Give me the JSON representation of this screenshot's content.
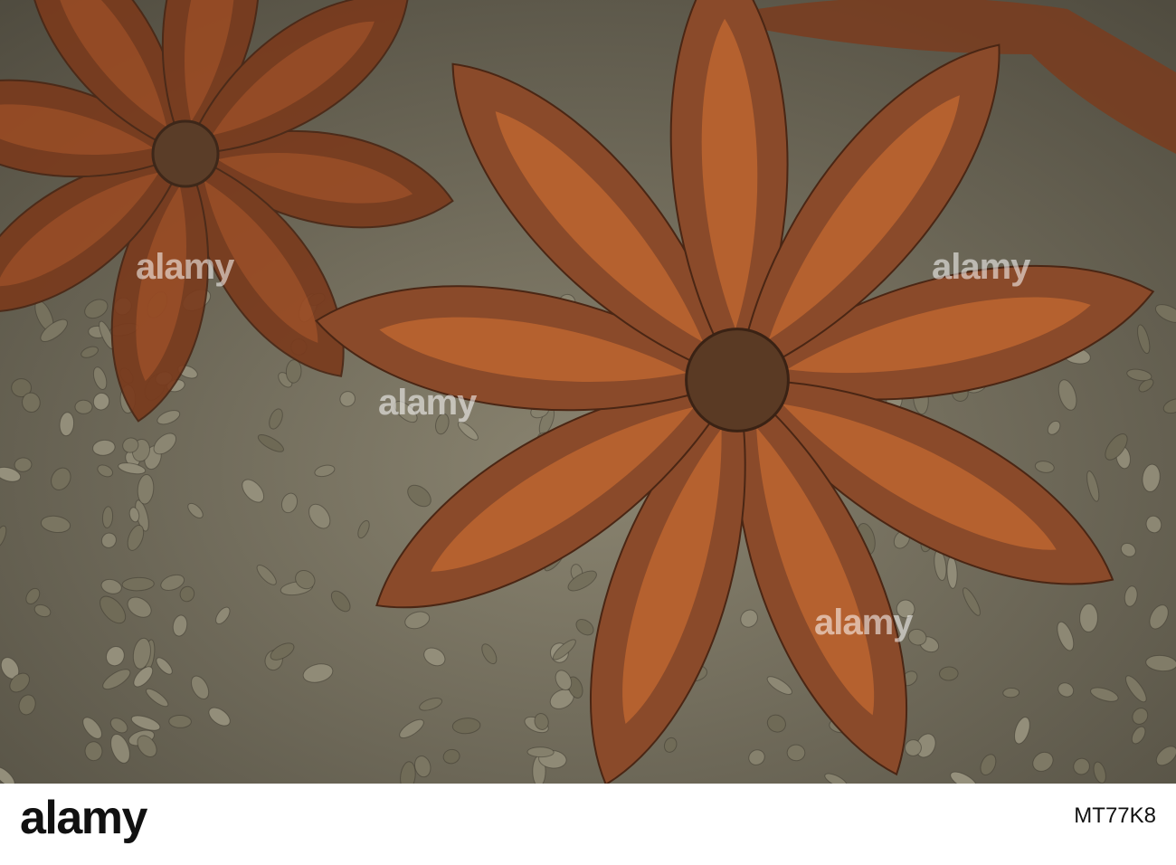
{
  "photo": {
    "subject": "star anise on anise seeds",
    "colors": {
      "pod": "#8a4a2a",
      "pod_inner": "#b5612f",
      "seeds": "#7d7865",
      "center": "#5a3a24"
    }
  },
  "watermarks": [
    "alamy",
    "alamy",
    "alamy",
    "alamy"
  ],
  "footer": {
    "logo": "alamy",
    "image_id": "MT77K8"
  }
}
